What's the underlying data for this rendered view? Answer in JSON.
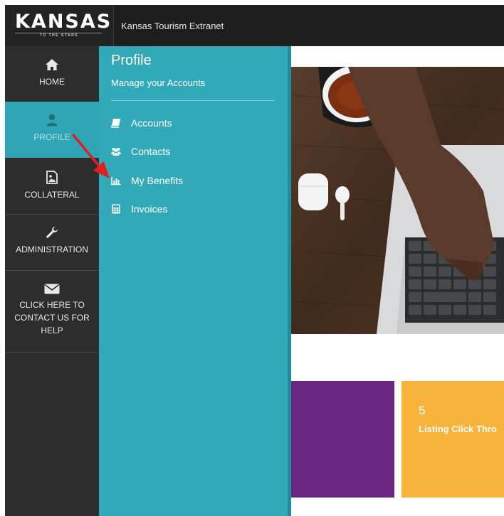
{
  "header": {
    "logo_text": "KANSAS",
    "logo_tagline": "TO THE STARS",
    "app_title": "Kansas Tourism Extranet"
  },
  "sidebar": {
    "items": [
      {
        "label": "HOME",
        "icon": "home-icon"
      },
      {
        "label": "PROFILE",
        "icon": "user-icon",
        "active": true
      },
      {
        "label": "COLLATERAL",
        "icon": "image-file-icon"
      },
      {
        "label": "ADMINISTRATION",
        "icon": "wrench-icon"
      },
      {
        "label": "CLICK HERE TO CONTACT US FOR HELP",
        "icon": "envelope-icon"
      }
    ]
  },
  "flyout": {
    "title": "Profile",
    "subtitle": "Manage your Accounts",
    "items": [
      {
        "label": "Accounts",
        "icon": "book-icon"
      },
      {
        "label": "Contacts",
        "icon": "users-icon"
      },
      {
        "label": "My Benefits",
        "icon": "bar-chart-icon"
      },
      {
        "label": "Invoices",
        "icon": "calculator-icon"
      }
    ]
  },
  "tiles": [
    {
      "number": "",
      "label": ""
    },
    {
      "number": "5",
      "label": "Listing Click Thro"
    }
  ],
  "colors": {
    "topbar": "#1e1e1e",
    "sidebar": "#2d2d2d",
    "accent_teal": "#31a9b8",
    "tile_purple": "#6b2682",
    "tile_yellow": "#f7b33a",
    "annotation_arrow": "#e02020"
  }
}
